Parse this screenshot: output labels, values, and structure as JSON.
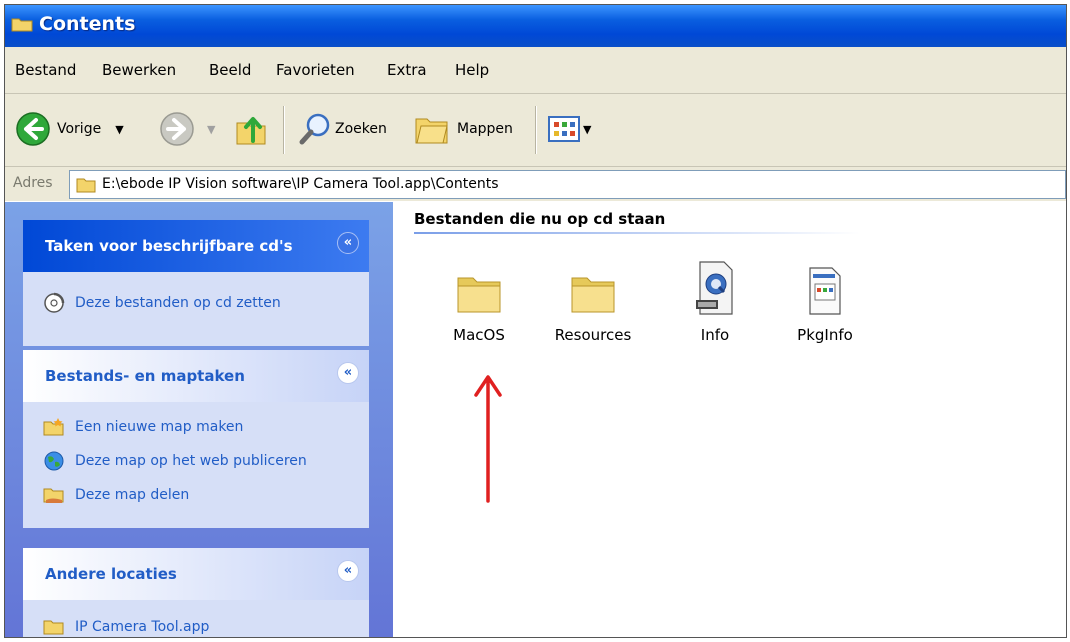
{
  "window": {
    "title": "Contents"
  },
  "menu": [
    "Bestand",
    "Bewerken",
    "Beeld",
    "Favorieten",
    "Extra",
    "Help"
  ],
  "toolbar": {
    "back_label": "Vorige",
    "search_label": "Zoeken",
    "folders_label": "Mappen"
  },
  "address": {
    "label": "Adres",
    "path": "E:\\ebode IP Vision software\\IP Camera Tool.app\\Contents"
  },
  "tasks_pane": {
    "cd_tasks": {
      "title": "Taken voor beschrijfbare cd's",
      "items": [
        "Deze bestanden op cd zetten"
      ]
    },
    "file_tasks": {
      "title": "Bestands- en maptaken",
      "items": [
        "Een nieuwe map maken",
        "Deze map op het web publiceren",
        "Deze map delen"
      ]
    },
    "other_places": {
      "title": "Andere locaties",
      "items": [
        "IP Camera Tool.app"
      ]
    }
  },
  "content": {
    "group_title": "Bestanden die nu op cd staan",
    "files": [
      {
        "name": "MacOS",
        "icon": "folder-icon"
      },
      {
        "name": "Resources",
        "icon": "folder-icon"
      },
      {
        "name": "Info",
        "icon": "quicktime-file-icon"
      },
      {
        "name": "PkgInfo",
        "icon": "document-file-icon"
      }
    ]
  },
  "colors": {
    "titlebar": "#0048d6",
    "task_link": "#215dc6",
    "annotation_arrow": "#e02020"
  }
}
